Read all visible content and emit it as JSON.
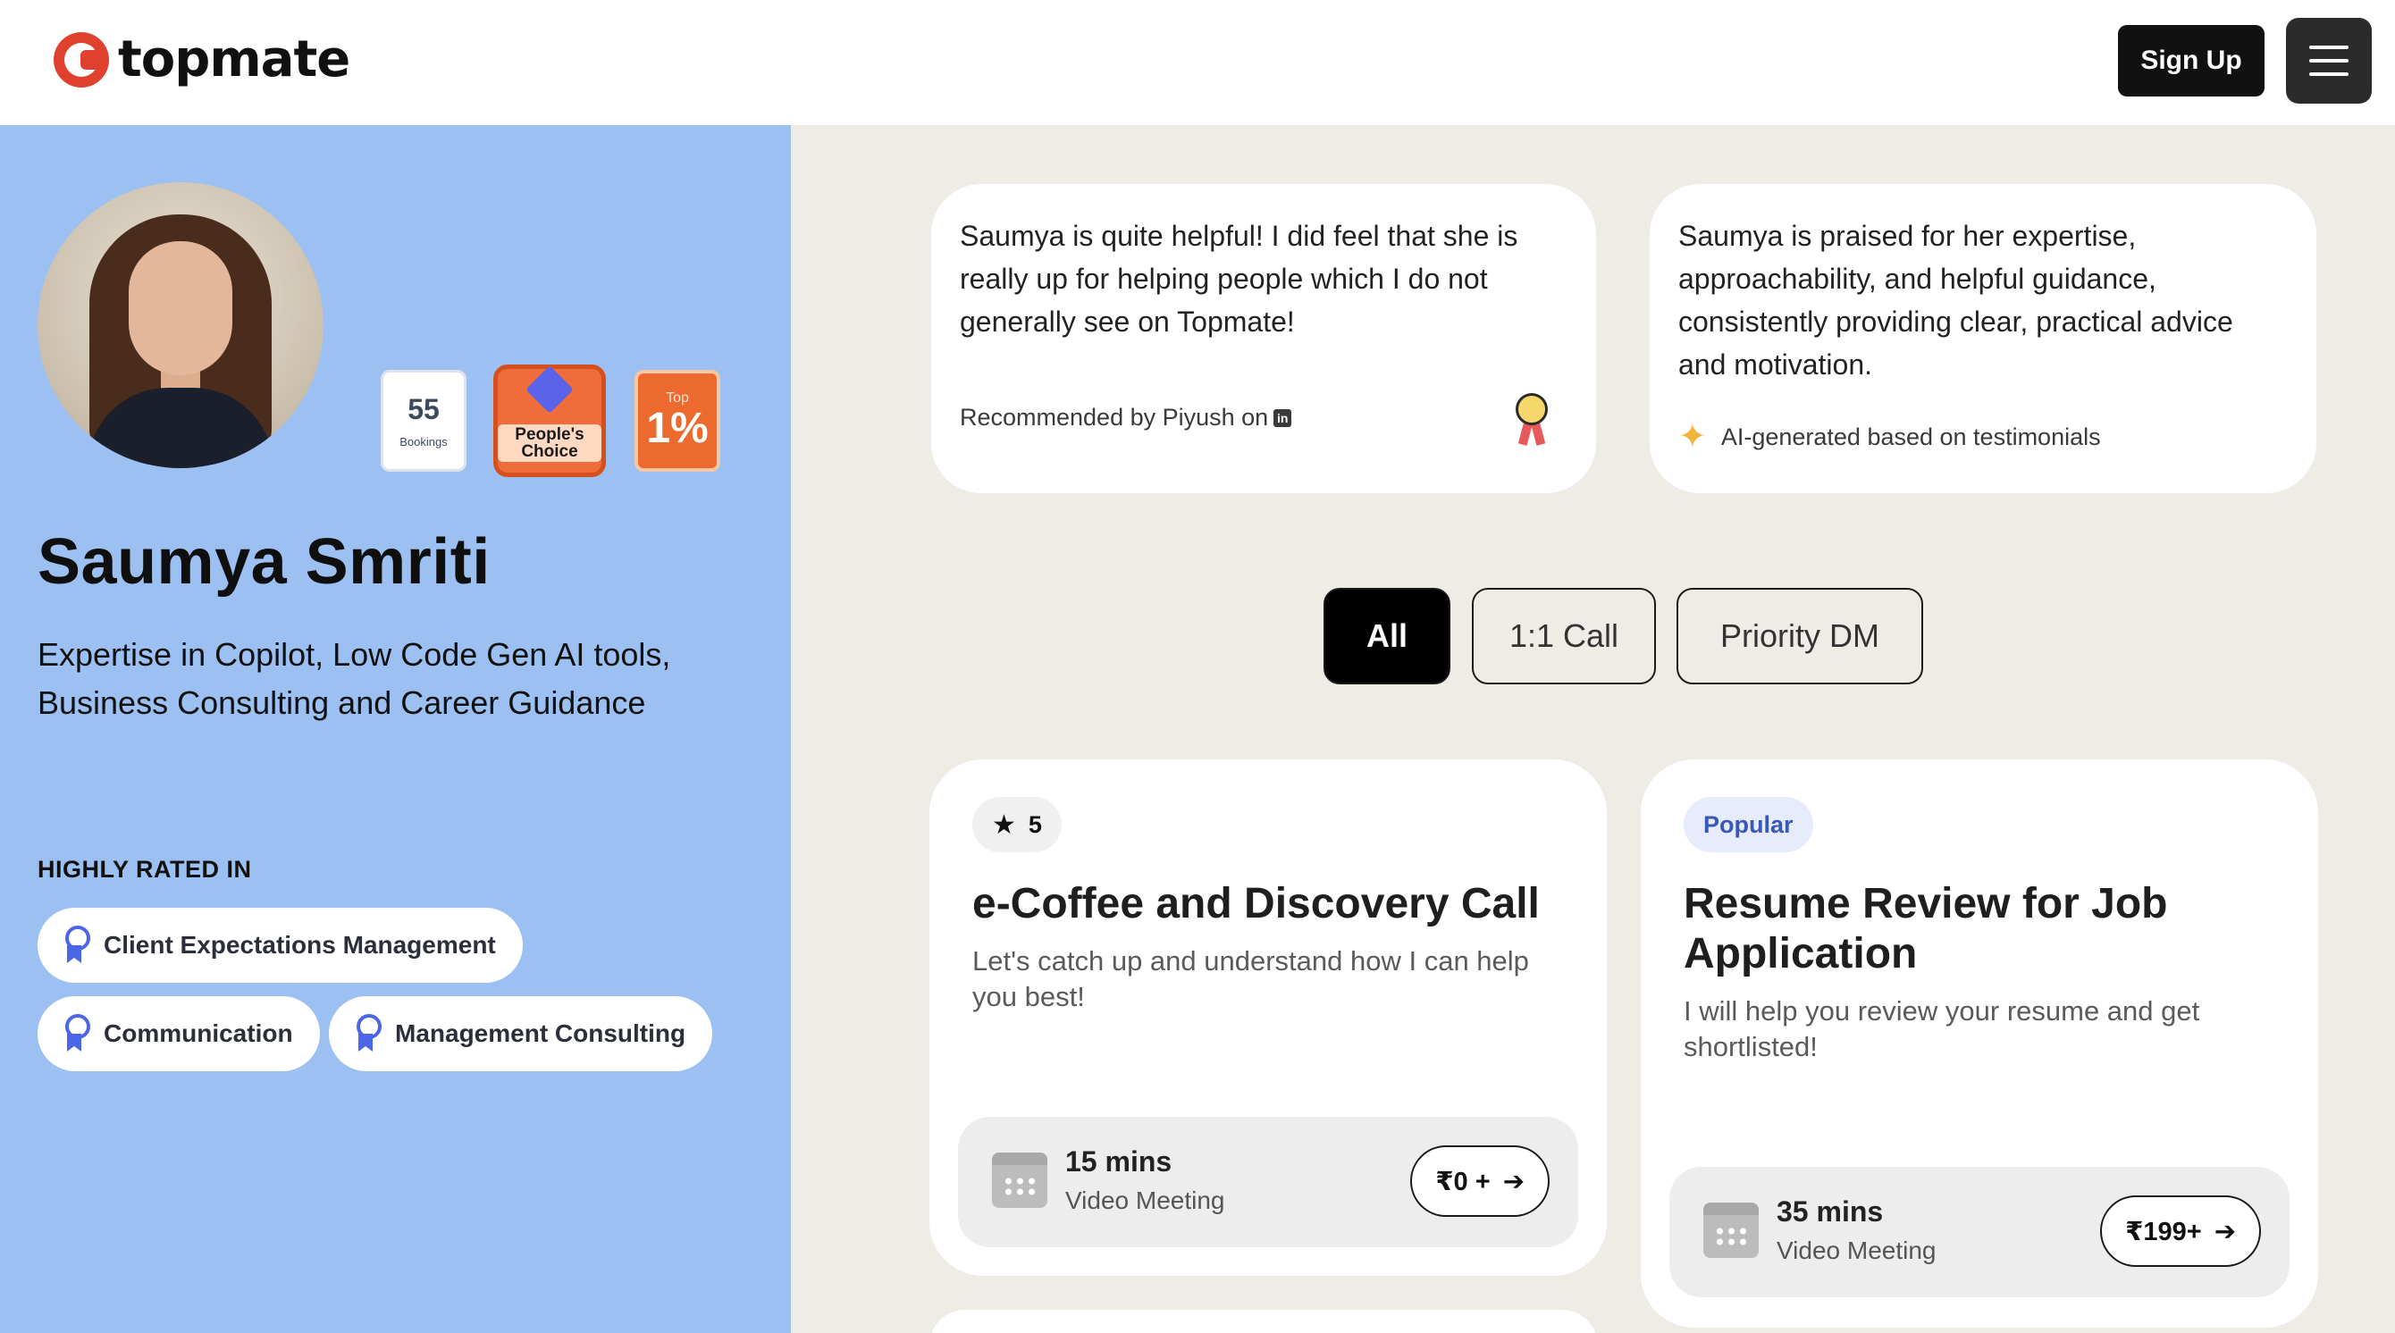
{
  "header": {
    "brand": "topmate",
    "signup_label": "Sign Up"
  },
  "profile": {
    "name": "Saumya Smriti",
    "description": "Expertise in Copilot, Low Code Gen AI tools, Business Consulting and Career Guidance",
    "badges": {
      "bookings_count": "55",
      "bookings_label": "Bookings",
      "choice_label": "People's Choice",
      "top_label": "Top",
      "top_value": "1%"
    },
    "highly_rated_heading": "HIGHLY RATED IN",
    "highly_rated": [
      "Client Expectations Management",
      "Communication",
      "Management Consulting"
    ]
  },
  "testimonials": [
    {
      "text": "Saumya is quite helpful! I did feel that she is really up for helping people which I do not generally see on Topmate!",
      "footer": "Recommended by Piyush on",
      "footer_icon": "linkedin-icon"
    },
    {
      "text": "Saumya is praised for her expertise, approachability, and helpful guidance, consistently providing clear, practical advice and motivation.",
      "footer": "AI-generated based on testimonials",
      "footer_icon": "sparkle-icon"
    }
  ],
  "filters": {
    "tabs": [
      "All",
      "1:1 Call",
      "Priority DM"
    ],
    "selected": "All"
  },
  "services": [
    {
      "chip": "5",
      "chip_icon": "star-icon",
      "title": "e-Coffee and Discovery Call",
      "description": "Let's catch up and understand how I can help you best!",
      "duration": "15 mins",
      "meeting_type": "Video Meeting",
      "price": "₹0 +"
    },
    {
      "chip": "Popular",
      "title": "Resume Review for Job Application",
      "description": "I will help you review your resume and get shortlisted!",
      "duration": "35 mins",
      "meeting_type": "Video Meeting",
      "price": "₹199+"
    }
  ],
  "colors": {
    "brand_red": "#e0412f",
    "left_panel": "#9cc0f2",
    "page_bg": "#efece6",
    "accent_blue": "#4b66e6"
  }
}
